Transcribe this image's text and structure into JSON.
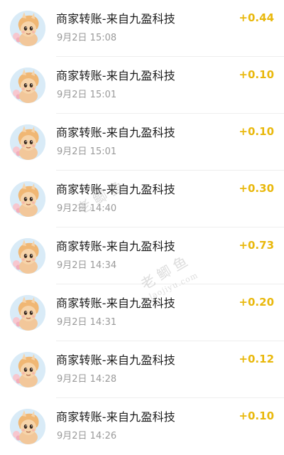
{
  "transactions": [
    {
      "title": "商家转账-来自九盈科技",
      "time": "9月2日 15:08",
      "amount": "+0.44"
    },
    {
      "title": "商家转账-来自九盈科技",
      "time": "9月2日 15:01",
      "amount": "+0.10"
    },
    {
      "title": "商家转账-来自九盈科技",
      "time": "9月2日 15:01",
      "amount": "+0.10"
    },
    {
      "title": "商家转账-来自九盈科技",
      "time": "9月2日 14:40",
      "amount": "+0.30"
    },
    {
      "title": "商家转账-来自九盈科技",
      "time": "9月2日 14:34",
      "amount": "+0.73"
    },
    {
      "title": "商家转账-来自九盈科技",
      "time": "9月2日 14:31",
      "amount": "+0.20"
    },
    {
      "title": "商家转账-来自九盈科技",
      "time": "9月2日 14:28",
      "amount": "+0.12"
    },
    {
      "title": "商家转账-来自九盈科技",
      "time": "9月2日 14:26",
      "amount": "+0.10"
    }
  ],
  "watermark": {
    "brand": "老鲫鱼",
    "url": "laojiyu.com"
  },
  "colors": {
    "amount": "#e9b80c",
    "title": "#1c1c1c",
    "time": "#9a9a9a",
    "avatar_bg": "#d9ebf7"
  },
  "icons": {
    "avatar": "cartoon-pony-avatar-icon"
  }
}
